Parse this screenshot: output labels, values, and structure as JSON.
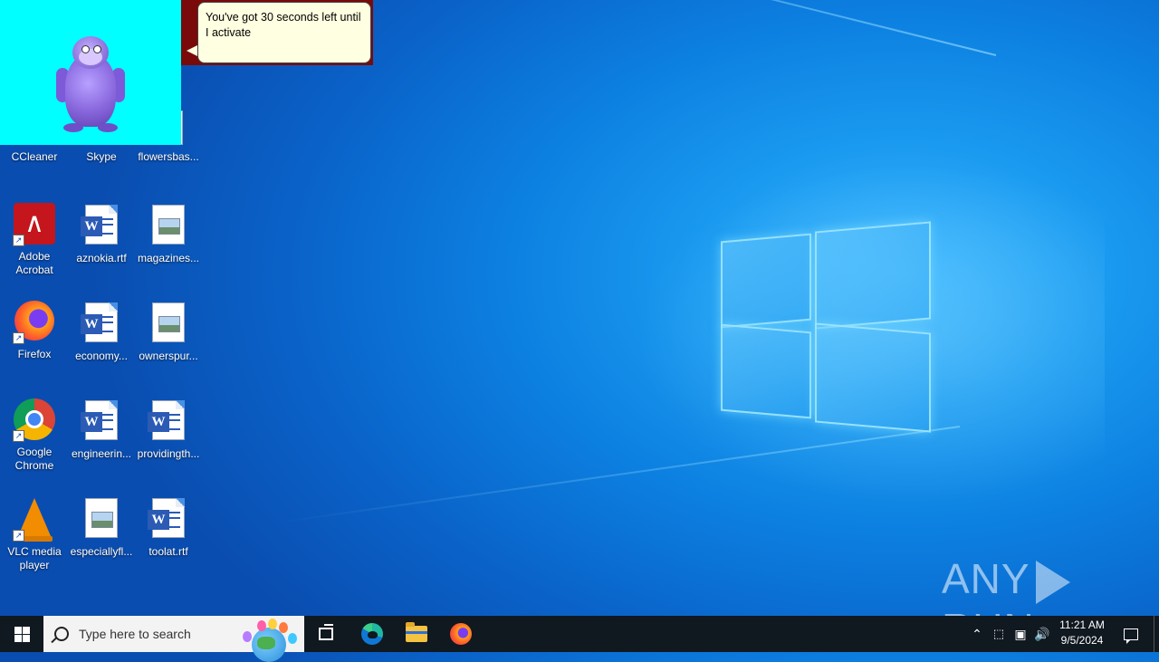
{
  "bonzi": {
    "speech_text": "You've got 30 seconds left until I activate"
  },
  "desktop_icons": [
    {
      "label": "CCleaner",
      "icon": "ccleaner-icon"
    },
    {
      "label": "Skype",
      "icon": "skype-icon"
    },
    {
      "label": "flowersbas...",
      "icon": "image-file-icon"
    },
    {
      "label": "Adobe Acrobat",
      "icon": "adobe-acrobat-icon"
    },
    {
      "label": "aznokia.rtf",
      "icon": "word-document-icon"
    },
    {
      "label": "magazines...",
      "icon": "image-file-icon"
    },
    {
      "label": "Firefox",
      "icon": "firefox-icon"
    },
    {
      "label": "economy...",
      "icon": "word-document-icon"
    },
    {
      "label": "ownerspur...",
      "icon": "image-file-icon"
    },
    {
      "label": "Google Chrome",
      "icon": "chrome-icon"
    },
    {
      "label": "engineerin...",
      "icon": "word-document-icon"
    },
    {
      "label": "providingth...",
      "icon": "word-document-icon"
    },
    {
      "label": "VLC media player",
      "icon": "vlc-icon"
    },
    {
      "label": "especiallyfl...",
      "icon": "image-file-icon"
    },
    {
      "label": "toolat.rtf",
      "icon": "word-document-icon"
    }
  ],
  "watermark": {
    "left": "ANY",
    "right": "RUN"
  },
  "taskbar": {
    "search_placeholder": "Type here to search",
    "pinned": [
      "task-view",
      "microsoft-edge",
      "file-explorer",
      "firefox"
    ],
    "clock_time": "11:21 AM",
    "clock_date": "9/5/2024"
  },
  "colors": {
    "desktop_blue": "#0c7fe0",
    "taskbar": "#101820",
    "bonzi_bg": "#00ffff",
    "speech_bg": "#ffffe1"
  }
}
